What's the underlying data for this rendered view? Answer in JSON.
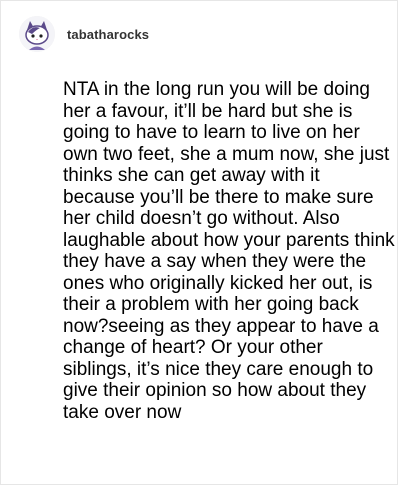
{
  "post": {
    "username": "tabatharocks",
    "avatar_icon": "cat-avatar-icon",
    "body": "NTA in the long run you will be doing her a favour, it’ll be hard but she is going to have to learn to live on her own two feet, she a mum now, she just thinks she can get away with it because you’ll be there to make sure her child doesn’t go without. Also laughable about how your parents think they have a say when they were the ones who originally kicked her out, is their a problem with her going back now?seeing as they appear to have a change of heart? Or your other siblings, it’s nice they care enough to give their opinion so how about they take over now"
  },
  "colors": {
    "username": "#333333",
    "text": "#000000",
    "avatar_accent": "#5b4a8a"
  }
}
